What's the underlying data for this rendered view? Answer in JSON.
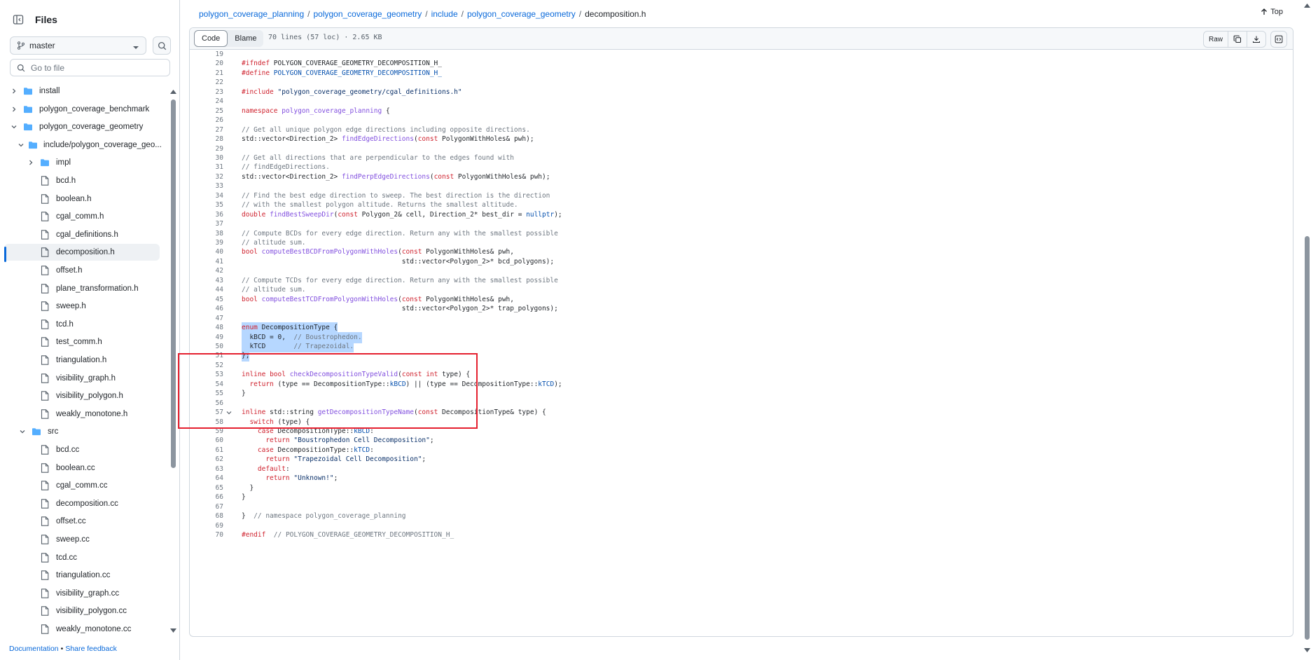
{
  "sidebar": {
    "title": "Files",
    "branch": "master",
    "goto_placeholder": "Go to file",
    "tree": [
      {
        "label": "install",
        "type": "folder",
        "chev": "right",
        "depth": 0
      },
      {
        "label": "polygon_coverage_benchmark",
        "type": "folder",
        "chev": "right",
        "depth": 0
      },
      {
        "label": "polygon_coverage_geometry",
        "type": "folder",
        "chev": "down",
        "depth": 0
      },
      {
        "label": "include/polygon_coverage_geo...",
        "type": "folder",
        "chev": "down",
        "depth": 1
      },
      {
        "label": "impl",
        "type": "folder",
        "chev": "right",
        "depth": 2
      },
      {
        "label": "bcd.h",
        "type": "file",
        "depth": 2
      },
      {
        "label": "boolean.h",
        "type": "file",
        "depth": 2
      },
      {
        "label": "cgal_comm.h",
        "type": "file",
        "depth": 2
      },
      {
        "label": "cgal_definitions.h",
        "type": "file",
        "depth": 2
      },
      {
        "label": "decomposition.h",
        "type": "file",
        "depth": 2,
        "selected": true
      },
      {
        "label": "offset.h",
        "type": "file",
        "depth": 2
      },
      {
        "label": "plane_transformation.h",
        "type": "file",
        "depth": 2
      },
      {
        "label": "sweep.h",
        "type": "file",
        "depth": 2
      },
      {
        "label": "tcd.h",
        "type": "file",
        "depth": 2
      },
      {
        "label": "test_comm.h",
        "type": "file",
        "depth": 2
      },
      {
        "label": "triangulation.h",
        "type": "file",
        "depth": 2
      },
      {
        "label": "visibility_graph.h",
        "type": "file",
        "depth": 2
      },
      {
        "label": "visibility_polygon.h",
        "type": "file",
        "depth": 2
      },
      {
        "label": "weakly_monotone.h",
        "type": "file",
        "depth": 2
      },
      {
        "label": "src",
        "type": "folder",
        "chev": "down",
        "depth": 1
      },
      {
        "label": "bcd.cc",
        "type": "file",
        "depth": 2
      },
      {
        "label": "boolean.cc",
        "type": "file",
        "depth": 2
      },
      {
        "label": "cgal_comm.cc",
        "type": "file",
        "depth": 2
      },
      {
        "label": "decomposition.cc",
        "type": "file",
        "depth": 2
      },
      {
        "label": "offset.cc",
        "type": "file",
        "depth": 2
      },
      {
        "label": "sweep.cc",
        "type": "file",
        "depth": 2
      },
      {
        "label": "tcd.cc",
        "type": "file",
        "depth": 2
      },
      {
        "label": "triangulation.cc",
        "type": "file",
        "depth": 2
      },
      {
        "label": "visibility_graph.cc",
        "type": "file",
        "depth": 2
      },
      {
        "label": "visibility_polygon.cc",
        "type": "file",
        "depth": 2
      },
      {
        "label": "weakly_monotone.cc",
        "type": "file",
        "depth": 2
      }
    ],
    "footer": {
      "documentation": "Documentation",
      "dot": "•",
      "feedback": "Share feedback"
    }
  },
  "breadcrumb": [
    {
      "label": "polygon_coverage_planning"
    },
    {
      "label": "polygon_coverage_geometry"
    },
    {
      "label": "include"
    },
    {
      "label": "polygon_coverage_geometry"
    }
  ],
  "breadcrumb_current": "decomposition.h",
  "breadcrumb_sep": "/",
  "top_label": "Top",
  "file_header": {
    "code_tab": "Code",
    "blame_tab": "Blame",
    "info": "70 lines (57 loc) · 2.65 KB",
    "raw": "Raw"
  },
  "colors": {
    "keyword": "#cf222e",
    "function": "#8250df",
    "comment": "#6e7781",
    "string": "#0a3069",
    "constant": "#0550ae",
    "plain": "#1f2328"
  },
  "code_lines": [
    {
      "n": "19",
      "segs": []
    },
    {
      "n": "20",
      "segs": [
        [
          "k",
          "#ifndef"
        ],
        [
          "p",
          " POLYGON_COVERAGE_GEOMETRY_DECOMPOSITION_H_"
        ]
      ]
    },
    {
      "n": "21",
      "segs": [
        [
          "k",
          "#define"
        ],
        [
          "c",
          " POLYGON_COVERAGE_GEOMETRY_DECOMPOSITION_H_"
        ]
      ]
    },
    {
      "n": "22",
      "segs": []
    },
    {
      "n": "23",
      "segs": [
        [
          "k",
          "#include"
        ],
        [
          "p",
          " "
        ],
        [
          "s",
          "\"polygon_coverage_geometry/cgal_definitions.h\""
        ]
      ]
    },
    {
      "n": "24",
      "segs": []
    },
    {
      "n": "25",
      "segs": [
        [
          "k",
          "namespace"
        ],
        [
          "p",
          " "
        ],
        [
          "f",
          "polygon_coverage_planning"
        ],
        [
          "p",
          " {"
        ]
      ]
    },
    {
      "n": "26",
      "segs": []
    },
    {
      "n": "27",
      "segs": [
        [
          "m",
          "// Get all unique polygon edge directions including opposite directions."
        ]
      ]
    },
    {
      "n": "28",
      "segs": [
        [
          "p",
          "std::vector<Direction_2> "
        ],
        [
          "f",
          "findEdgeDirections"
        ],
        [
          "p",
          "("
        ],
        [
          "k",
          "const"
        ],
        [
          "p",
          " PolygonWithHoles& pwh);"
        ]
      ]
    },
    {
      "n": "29",
      "segs": []
    },
    {
      "n": "30",
      "segs": [
        [
          "m",
          "// Get all directions that are perpendicular to the edges found with"
        ]
      ]
    },
    {
      "n": "31",
      "segs": [
        [
          "m",
          "// findEdgeDirections."
        ]
      ]
    },
    {
      "n": "32",
      "segs": [
        [
          "p",
          "std::vector<Direction_2> "
        ],
        [
          "f",
          "findPerpEdgeDirections"
        ],
        [
          "p",
          "("
        ],
        [
          "k",
          "const"
        ],
        [
          "p",
          " PolygonWithHoles& pwh);"
        ]
      ]
    },
    {
      "n": "33",
      "segs": []
    },
    {
      "n": "34",
      "segs": [
        [
          "m",
          "// Find the best edge direction to sweep. The best direction is the direction"
        ]
      ]
    },
    {
      "n": "35",
      "segs": [
        [
          "m",
          "// with the smallest polygon altitude. Returns the smallest altitude."
        ]
      ]
    },
    {
      "n": "36",
      "segs": [
        [
          "k",
          "double"
        ],
        [
          "p",
          " "
        ],
        [
          "f",
          "findBestSweepDir"
        ],
        [
          "p",
          "("
        ],
        [
          "k",
          "const"
        ],
        [
          "p",
          " Polygon_2& cell, Direction_2* best_dir = "
        ],
        [
          "c",
          "nullptr"
        ],
        [
          "p",
          ");"
        ]
      ]
    },
    {
      "n": "37",
      "segs": []
    },
    {
      "n": "38",
      "segs": [
        [
          "m",
          "// Compute BCDs for every edge direction. Return any with the smallest possible"
        ]
      ]
    },
    {
      "n": "39",
      "segs": [
        [
          "m",
          "// altitude sum."
        ]
      ]
    },
    {
      "n": "40",
      "segs": [
        [
          "k",
          "bool"
        ],
        [
          "p",
          " "
        ],
        [
          "f",
          "computeBestBCDFromPolygonWithHoles"
        ],
        [
          "p",
          "("
        ],
        [
          "k",
          "const"
        ],
        [
          "p",
          " PolygonWithHoles& pwh,"
        ]
      ]
    },
    {
      "n": "41",
      "segs": [
        [
          "p",
          "                                        std::vector<Polygon_2>* bcd_polygons);"
        ]
      ]
    },
    {
      "n": "42",
      "segs": []
    },
    {
      "n": "43",
      "segs": [
        [
          "m",
          "// Compute TCDs for every edge direction. Return any with the smallest possible"
        ]
      ]
    },
    {
      "n": "44",
      "segs": [
        [
          "m",
          "// altitude sum."
        ]
      ]
    },
    {
      "n": "45",
      "segs": [
        [
          "k",
          "bool"
        ],
        [
          "p",
          " "
        ],
        [
          "f",
          "computeBestTCDFromPolygonWithHoles"
        ],
        [
          "p",
          "("
        ],
        [
          "k",
          "const"
        ],
        [
          "p",
          " PolygonWithHoles& pwh,"
        ]
      ]
    },
    {
      "n": "46",
      "segs": [
        [
          "p",
          "                                        std::vector<Polygon_2>* trap_polygons);"
        ]
      ]
    },
    {
      "n": "47",
      "segs": []
    },
    {
      "n": "48",
      "hl": true,
      "segs": [
        [
          "k",
          "enum"
        ],
        [
          "p",
          " DecompositionType {"
        ]
      ]
    },
    {
      "n": "49",
      "hl": true,
      "segs": [
        [
          "p",
          "  kBCD = 0,  "
        ],
        [
          "m",
          "// Boustrophedon."
        ]
      ]
    },
    {
      "n": "50",
      "hl": true,
      "segs": [
        [
          "p",
          "  kTCD       "
        ],
        [
          "m",
          "// Trapezoidal."
        ]
      ]
    },
    {
      "n": "51",
      "hl": true,
      "segs": [
        [
          "p",
          "};"
        ]
      ]
    },
    {
      "n": "52",
      "segs": []
    },
    {
      "n": "53",
      "segs": [
        [
          "k",
          "inline"
        ],
        [
          "p",
          " "
        ],
        [
          "k",
          "bool"
        ],
        [
          "p",
          " "
        ],
        [
          "f",
          "checkDecompositionTypeValid"
        ],
        [
          "p",
          "("
        ],
        [
          "k",
          "const"
        ],
        [
          "p",
          " "
        ],
        [
          "k",
          "int"
        ],
        [
          "p",
          " type) {"
        ]
      ]
    },
    {
      "n": "54",
      "segs": [
        [
          "p",
          "  "
        ],
        [
          "k",
          "return"
        ],
        [
          "p",
          " (type == DecompositionType::"
        ],
        [
          "c",
          "kBCD"
        ],
        [
          "p",
          ") || (type == DecompositionType::"
        ],
        [
          "c",
          "kTCD"
        ],
        [
          "p",
          ");"
        ]
      ]
    },
    {
      "n": "55",
      "segs": [
        [
          "p",
          "}"
        ]
      ]
    },
    {
      "n": "56",
      "segs": []
    },
    {
      "n": "57",
      "fold": true,
      "segs": [
        [
          "k",
          "inline"
        ],
        [
          "p",
          " std::string "
        ],
        [
          "f",
          "getDecompositionTypeName"
        ],
        [
          "p",
          "("
        ],
        [
          "k",
          "const"
        ],
        [
          "p",
          " DecompositionType& type) {"
        ]
      ]
    },
    {
      "n": "58",
      "segs": [
        [
          "p",
          "  "
        ],
        [
          "k",
          "switch"
        ],
        [
          "p",
          " (type) {"
        ]
      ]
    },
    {
      "n": "59",
      "segs": [
        [
          "p",
          "    "
        ],
        [
          "k",
          "case"
        ],
        [
          "p",
          " DecompositionType::"
        ],
        [
          "c",
          "kBCD"
        ],
        [
          "p",
          ":"
        ]
      ]
    },
    {
      "n": "60",
      "segs": [
        [
          "p",
          "      "
        ],
        [
          "k",
          "return"
        ],
        [
          "p",
          " "
        ],
        [
          "s",
          "\"Boustrophedon Cell Decomposition\""
        ],
        [
          "p",
          ";"
        ]
      ]
    },
    {
      "n": "61",
      "segs": [
        [
          "p",
          "    "
        ],
        [
          "k",
          "case"
        ],
        [
          "p",
          " DecompositionType::"
        ],
        [
          "c",
          "kTCD"
        ],
        [
          "p",
          ":"
        ]
      ]
    },
    {
      "n": "62",
      "segs": [
        [
          "p",
          "      "
        ],
        [
          "k",
          "return"
        ],
        [
          "p",
          " "
        ],
        [
          "s",
          "\"Trapezoidal Cell Decomposition\""
        ],
        [
          "p",
          ";"
        ]
      ]
    },
    {
      "n": "63",
      "segs": [
        [
          "p",
          "    "
        ],
        [
          "k",
          "default"
        ],
        [
          "p",
          ":"
        ]
      ]
    },
    {
      "n": "64",
      "segs": [
        [
          "p",
          "      "
        ],
        [
          "k",
          "return"
        ],
        [
          "p",
          " "
        ],
        [
          "s",
          "\"Unknown!\""
        ],
        [
          "p",
          ";"
        ]
      ]
    },
    {
      "n": "65",
      "segs": [
        [
          "p",
          "  }"
        ]
      ]
    },
    {
      "n": "66",
      "segs": [
        [
          "p",
          "}"
        ]
      ]
    },
    {
      "n": "67",
      "segs": []
    },
    {
      "n": "68",
      "segs": [
        [
          "p",
          "}  "
        ],
        [
          "m",
          "// namespace polygon_coverage_planning"
        ]
      ]
    },
    {
      "n": "69",
      "segs": []
    },
    {
      "n": "70",
      "segs": [
        [
          "k",
          "#endif"
        ],
        [
          "p",
          "  "
        ],
        [
          "m",
          "// POLYGON_COVERAGE_GEOMETRY_DECOMPOSITION_H_"
        ]
      ]
    }
  ]
}
